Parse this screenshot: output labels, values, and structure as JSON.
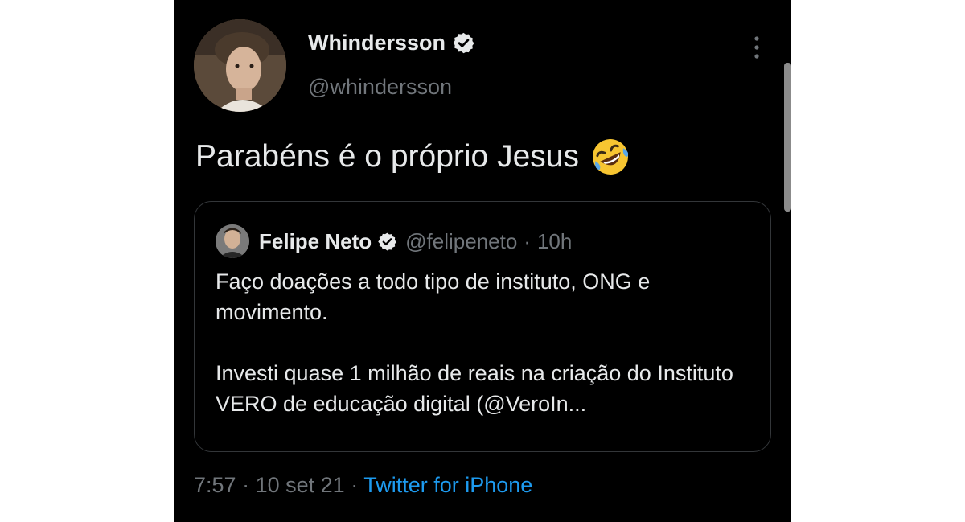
{
  "tweet": {
    "author_name": "Whindersson",
    "author_handle": "@whindersson",
    "text": "Parabéns é o próprio Jesus",
    "emoji": "rolling-on-the-floor-laughing-emoji",
    "time": "7:57",
    "date": "10 set 21",
    "separator": "·",
    "source": "Twitter for iPhone"
  },
  "quoted_tweet": {
    "author_name": "Felipe Neto",
    "author_handle": "@felipeneto",
    "separator": "·",
    "age": "10h",
    "line1": "Faço doações a todo tipo de instituto, ONG e movimento.",
    "line2": "Investi quase 1 milhão de reais na criação do Instituto VERO de educação digital (@VeroIn..."
  },
  "icons": {
    "verified": "verified-badge-icon",
    "more": "more-vertical-icon"
  },
  "colors": {
    "background": "#000000",
    "text": "#e7e9ea",
    "secondary": "#71767b",
    "link": "#1d9bf0",
    "border": "#333639"
  }
}
